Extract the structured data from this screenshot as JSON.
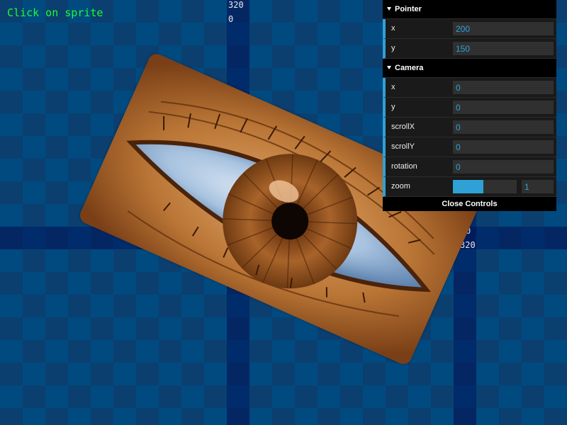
{
  "scene": {
    "hint": "Click on sprite",
    "axis_top_labels": [
      "320",
      "0"
    ],
    "axis_right_labels": [
      "0",
      "320"
    ]
  },
  "gui": {
    "pointer": {
      "title": "Pointer",
      "x_label": "x",
      "x_value": "200",
      "y_label": "y",
      "y_value": "150"
    },
    "camera": {
      "title": "Camera",
      "x_label": "x",
      "x_value": "0",
      "y_label": "y",
      "y_value": "0",
      "scrollx_label": "scrollX",
      "scrollx_value": "0",
      "scrolly_label": "scrollY",
      "scrolly_value": "0",
      "rotation_label": "rotation",
      "rotation_value": "0",
      "zoom_label": "zoom",
      "zoom_value": "1",
      "zoom_fraction": 0.48
    },
    "close_label": "Close Controls"
  },
  "colors": {
    "accent": "#2fa1d6",
    "hint_text": "#19ff2f"
  },
  "icons": [
    "triangle-down-icon"
  ]
}
